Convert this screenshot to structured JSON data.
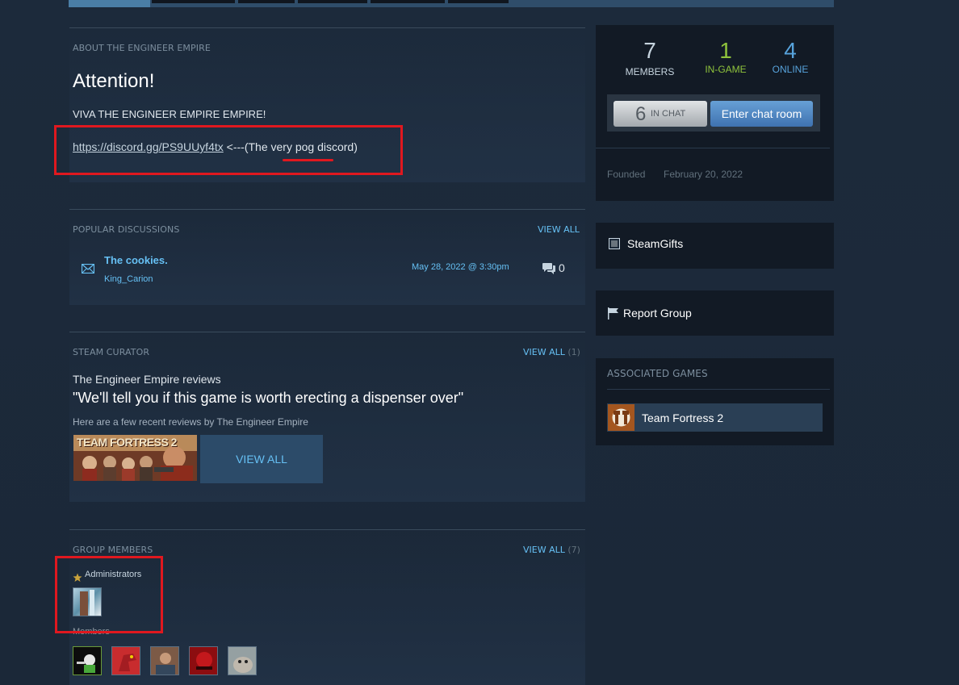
{
  "about": {
    "section_title": "ABOUT THE ENGINEER EMPIRE",
    "heading": "Attention!",
    "line1": "VIVA THE ENGINEER EMPIRE EMPIRE!",
    "discord_url": "https://discord.gg/PS9UUyf4tx",
    "discord_suffix": " <---(The very pog discord)"
  },
  "discussions": {
    "section_title": "POPULAR DISCUSSIONS",
    "view_all": "VIEW ALL",
    "items": [
      {
        "title": "The cookies.",
        "author": "King_Carion",
        "date": "May 28, 2022 @ 3:30pm",
        "replies": "0"
      }
    ]
  },
  "curator": {
    "section_title": "STEAM CURATOR",
    "view_all": "VIEW ALL",
    "view_all_count": "(1)",
    "name": "The Engineer Empire reviews",
    "quote": "\"We'll tell you if this game is worth erecting a dispenser over\"",
    "desc": "Here are a few recent reviews by The Engineer Empire",
    "capsule_text": "TEAM FORTRESS 2",
    "view_all_button": "VIEW ALL"
  },
  "members": {
    "section_title": "GROUP MEMBERS",
    "view_all": "VIEW ALL",
    "view_all_count": "(7)",
    "admins_label": "Administrators",
    "members_label": "Members"
  },
  "stats": {
    "members_count": "7",
    "members_label": "MEMBERS",
    "ingame_count": "1",
    "ingame_label": "IN-GAME",
    "online_count": "4",
    "online_label": "ONLINE",
    "inchat_count": "6",
    "inchat_label": "IN CHAT",
    "enter_chat": "Enter chat room",
    "founded_label": "Founded",
    "founded_date": "February 20, 2022"
  },
  "links": {
    "steamgifts": "SteamGifts",
    "report": "Report Group"
  },
  "games": {
    "section_title": "ASSOCIATED GAMES",
    "items": [
      {
        "name": "Team Fortress 2"
      }
    ]
  },
  "colors": {
    "accent": "#66c0f4",
    "ingame": "#8fc33c",
    "online": "#57a3dc",
    "annotation": "#e0181f"
  }
}
